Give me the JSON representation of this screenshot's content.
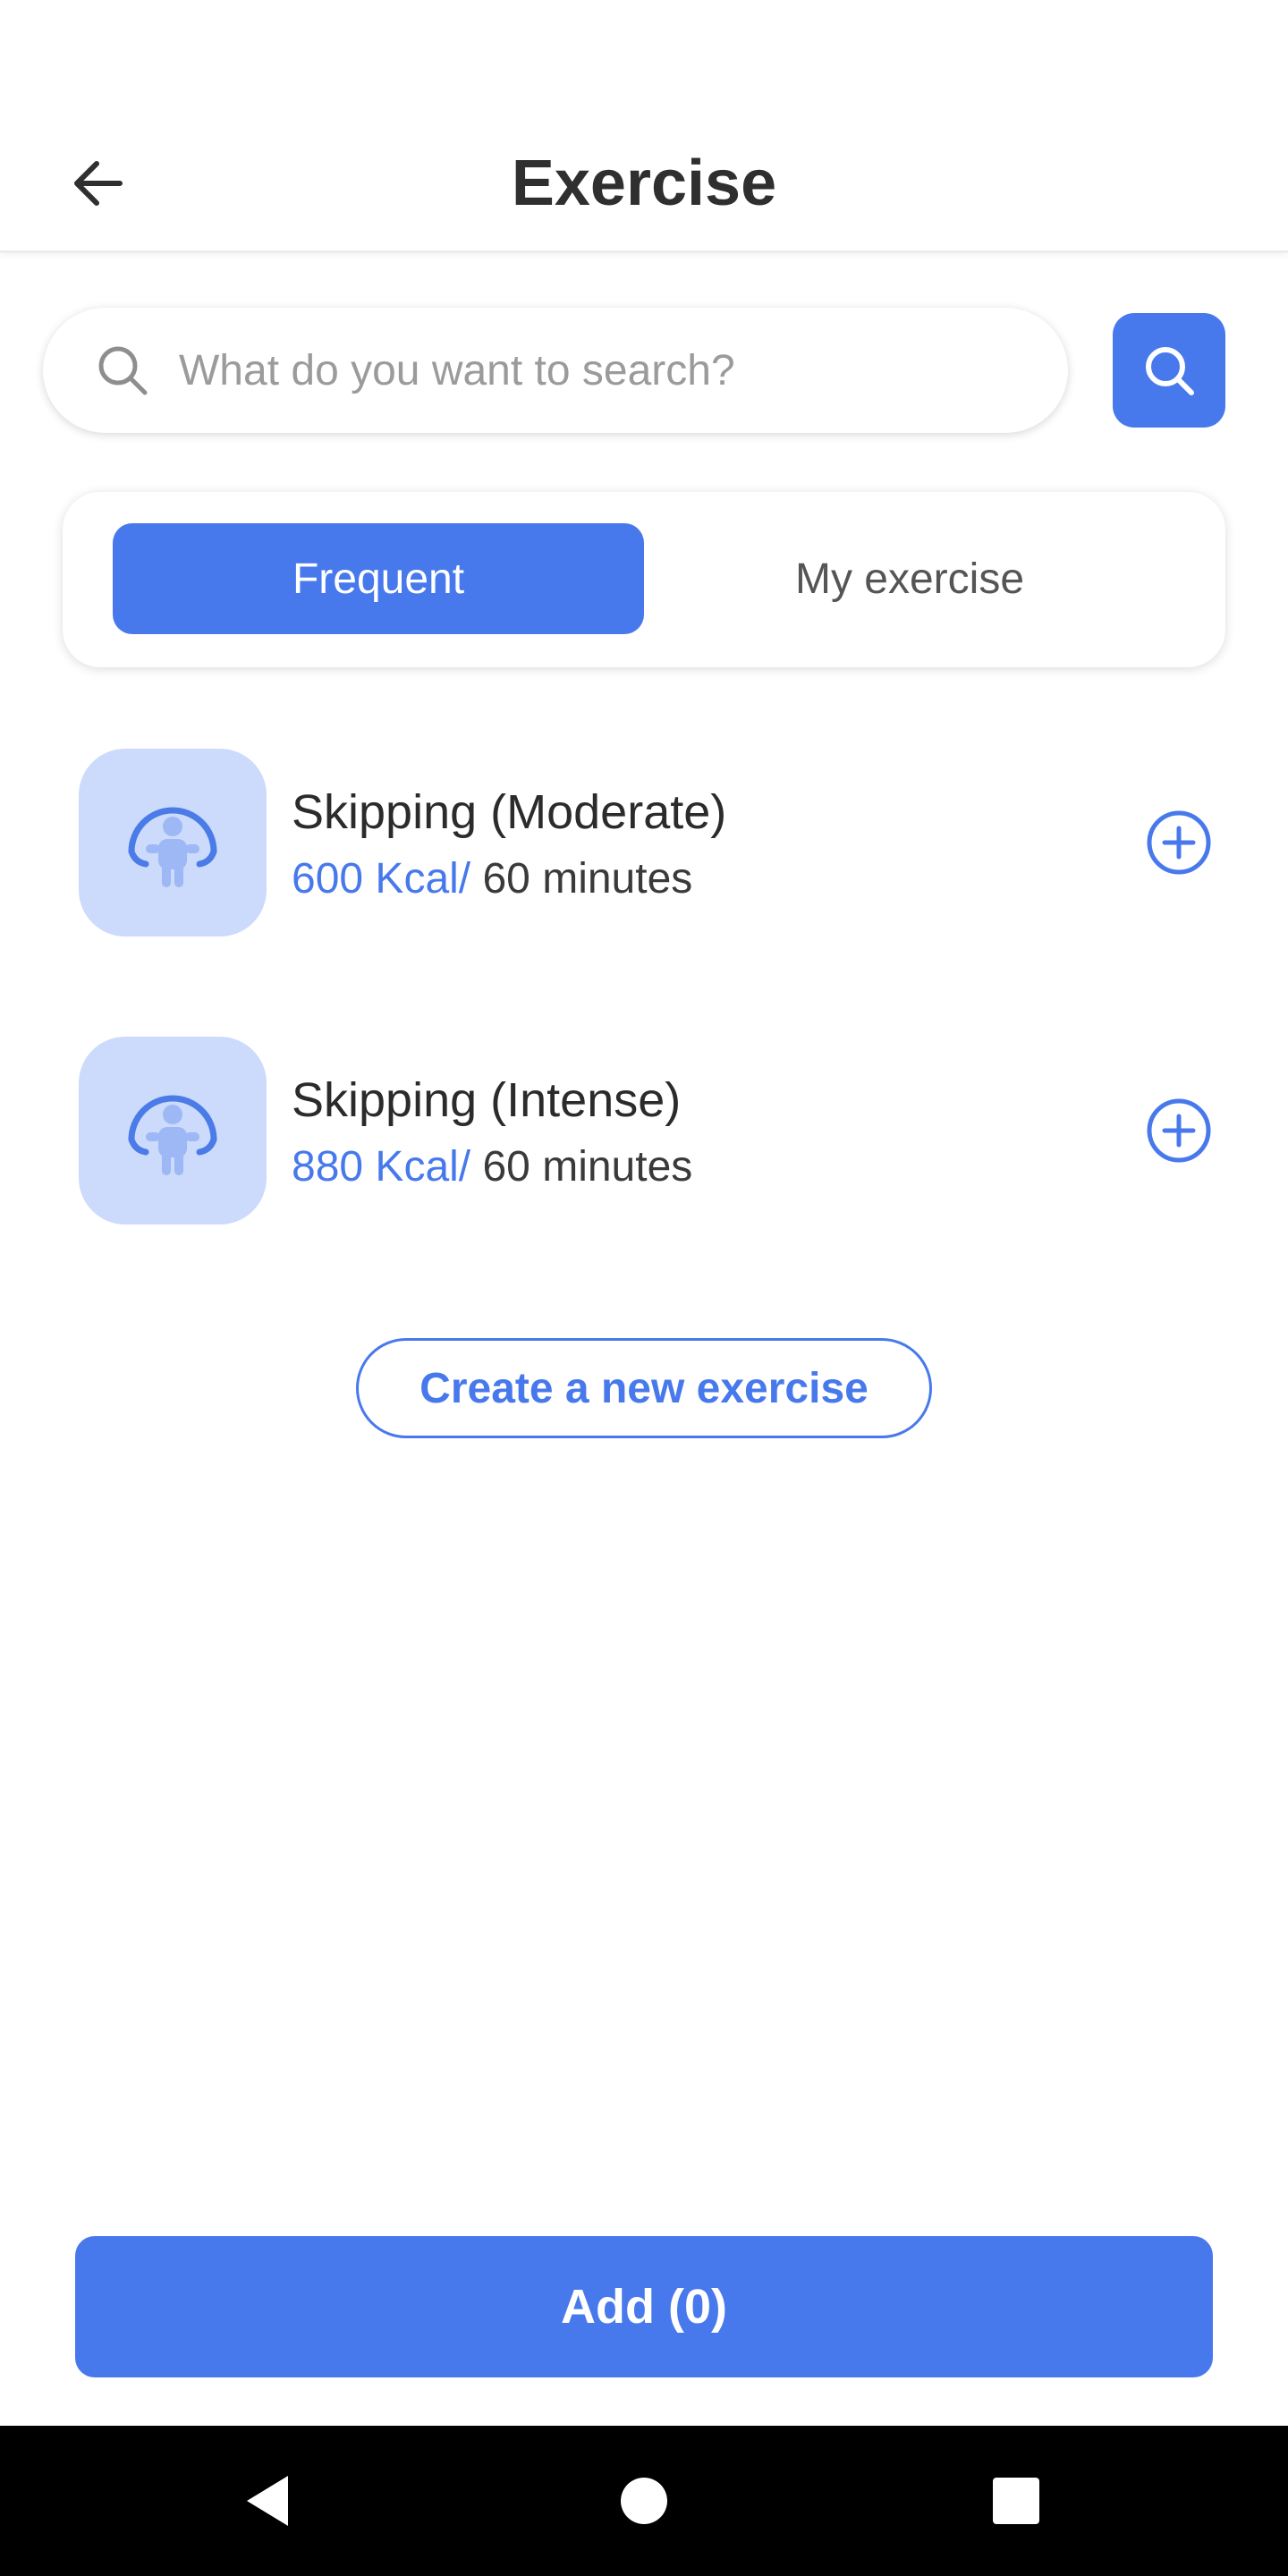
{
  "header": {
    "title": "Exercise",
    "back_icon": "arrow-left-icon"
  },
  "search": {
    "placeholder": "What do you want to search?",
    "value": "",
    "icon": "search-icon"
  },
  "tabs": [
    {
      "label": "Frequent",
      "active": true
    },
    {
      "label": "My exercise",
      "active": false
    }
  ],
  "exercises": [
    {
      "name": "Skipping (Moderate)",
      "kcal": "600 Kcal/",
      "duration": " 60 minutes",
      "icon": "jump-rope-icon"
    },
    {
      "name": "Skipping (Intense)",
      "kcal": "880 Kcal/",
      "duration": " 60 minutes",
      "icon": "jump-rope-icon"
    }
  ],
  "create_button_label": "Create a new exercise",
  "add_button_label": "Add (0)",
  "colors": {
    "accent": "#4879ec",
    "thumb_bg": "#ccdafc",
    "figure": "#9db8f4",
    "text": "#2b2b2b",
    "nav_bg": "#000000"
  },
  "nav": {
    "back_icon": "nav-back-triangle-icon",
    "home_icon": "nav-home-circle-icon",
    "recents_icon": "nav-recents-square-icon"
  }
}
